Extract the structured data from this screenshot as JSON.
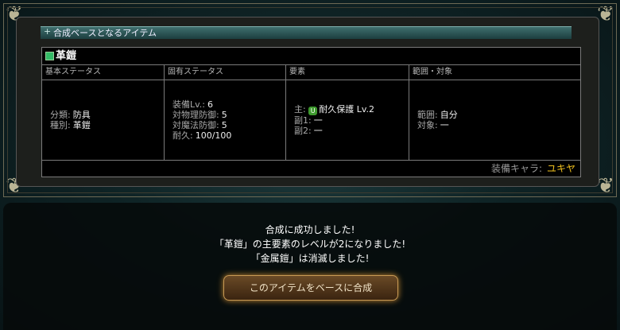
{
  "panel": {
    "title": "合成ベースとなるアイテム"
  },
  "item": {
    "name": "革鎧"
  },
  "columns": {
    "basic": {
      "header": "基本ステータス",
      "rows": [
        {
          "k": "分類:",
          "v": "防具"
        },
        {
          "k": "種別:",
          "v": "革鎧"
        }
      ]
    },
    "unique": {
      "header": "固有ステータス",
      "rows": [
        {
          "k": "装備Lv.:",
          "v": "6"
        },
        {
          "k": "対物理防御:",
          "v": "5"
        },
        {
          "k": "対魔法防御:",
          "v": "5"
        },
        {
          "k": "耐久:",
          "v": "100/100"
        }
      ]
    },
    "element": {
      "header": "要素",
      "main_label": "主:",
      "main_icon": "U",
      "main_value": "耐久保護 Lv.2",
      "sub1_label": "副1:",
      "sub1_value": "一",
      "sub2_label": "副2:",
      "sub2_value": "一"
    },
    "range": {
      "header": "範囲・対象",
      "rows": [
        {
          "k": "範囲:",
          "v": "自分"
        },
        {
          "k": "対象:",
          "v": "一"
        }
      ]
    }
  },
  "equip": {
    "label": "装備キャラ:",
    "value": "ユキヤ"
  },
  "messages": {
    "line1": "合成に成功しました!",
    "line2": "「革鎧」の主要素のレベルが2になりました!",
    "line3": "「金属鎧」は消滅しました!"
  },
  "button": {
    "label": "このアイテムをベースに合成"
  },
  "colors": {
    "accent": "#f0c01e",
    "button_glow": "#c98a33"
  }
}
